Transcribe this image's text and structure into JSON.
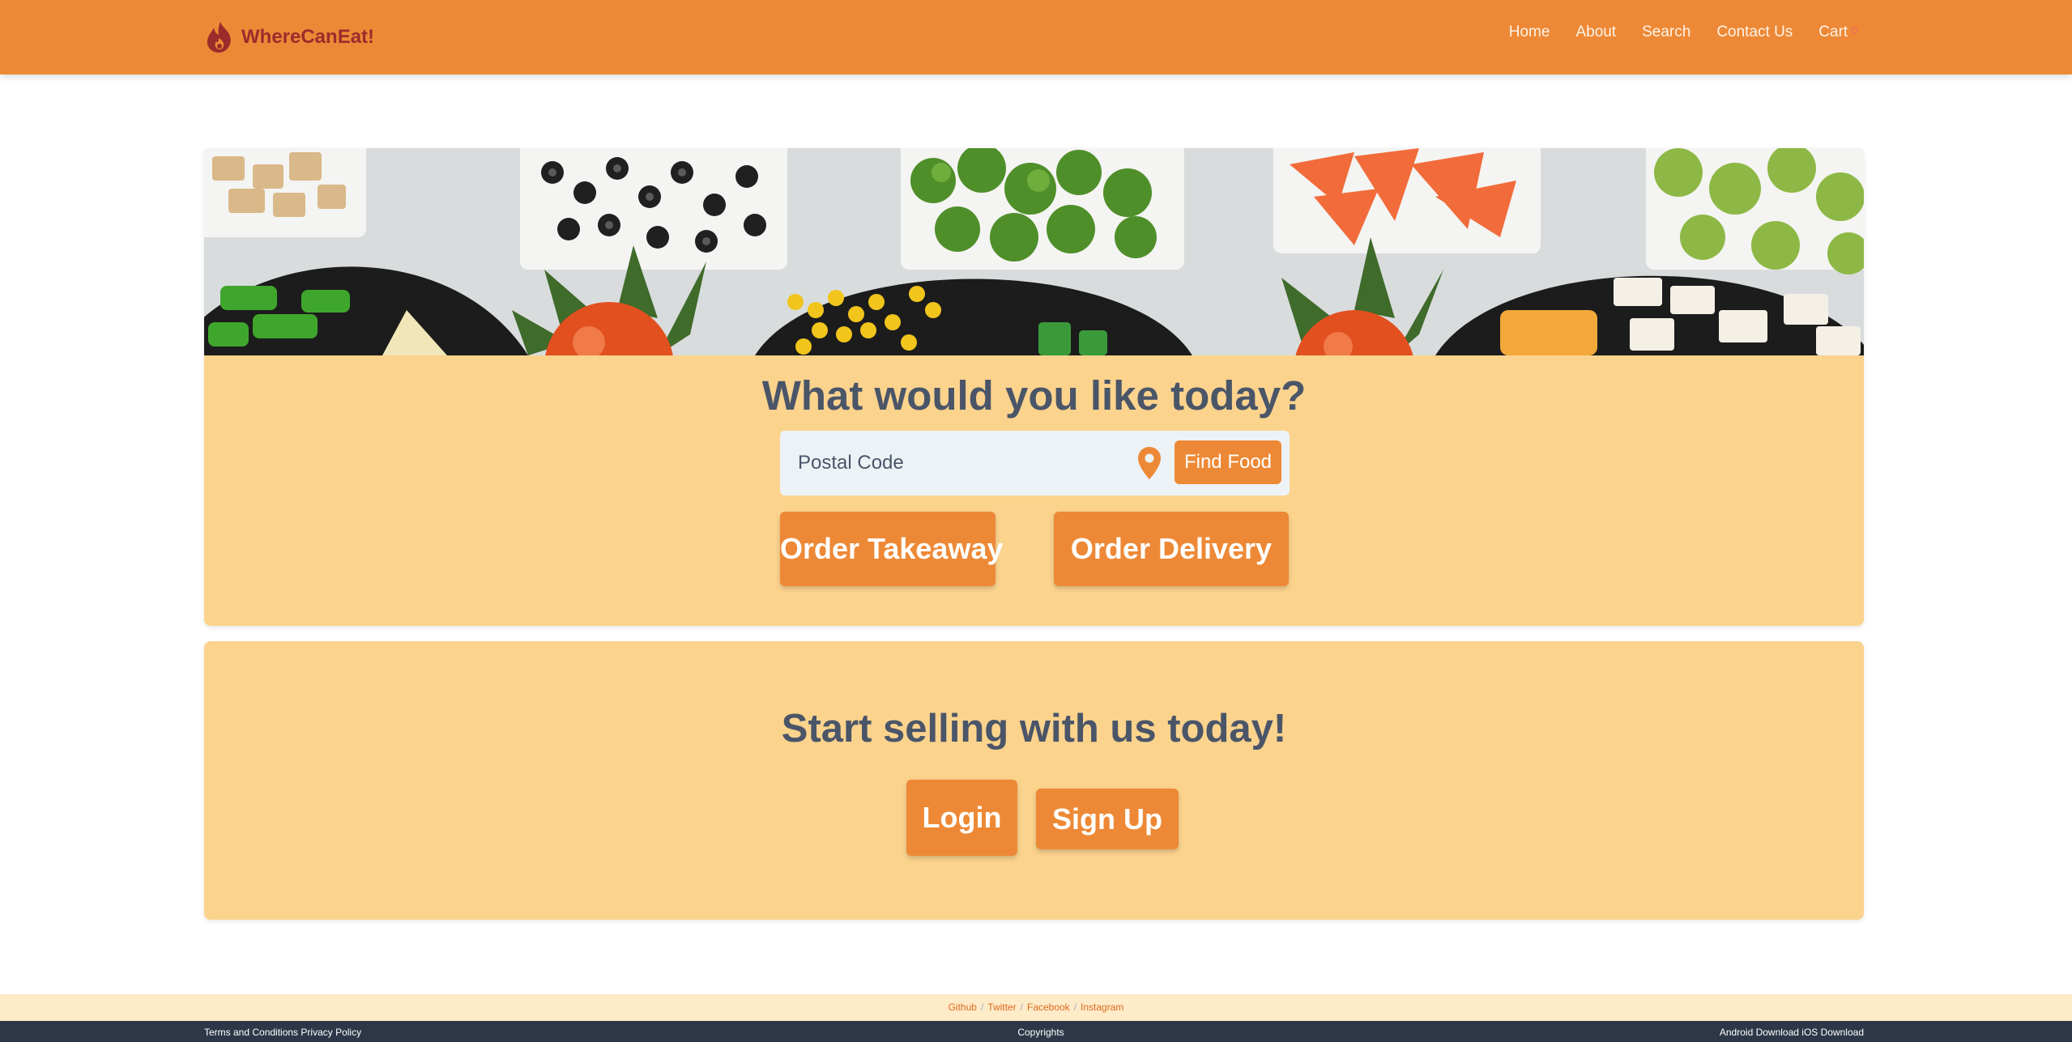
{
  "nav": {
    "brand": "WhereCanEat!",
    "links": [
      "Home",
      "About",
      "Search",
      "Contact Us",
      "Cart"
    ],
    "cart_count": "0"
  },
  "hero": {
    "title": "What would you like today?",
    "search_placeholder": "Postal Code",
    "find_button": "Find Food",
    "takeaway_button": "Order Takeaway",
    "delivery_button": "Order Delivery"
  },
  "sell": {
    "title": "Start selling with us today!",
    "login_button": "Login",
    "signup_button": "Sign Up"
  },
  "footer": {
    "social": [
      "Github",
      "Twitter",
      "Facebook",
      "Instagram"
    ],
    "separator": "/",
    "terms": "Terms and Conditions",
    "privacy": "Privacy Policy",
    "copyrights": "Copyrights",
    "android": "Android Download",
    "ios": "iOS Download"
  },
  "colors": {
    "navbar": "#ed8936",
    "card": "#fbd38d",
    "button": "#ed8936",
    "heading": "#4a5568",
    "footer_top": "#feebc8",
    "footer_bottom": "#2d3748",
    "brand_text": "#9b2c2c"
  },
  "icons": [
    "flame-logo-icon",
    "map-pin-icon"
  ]
}
